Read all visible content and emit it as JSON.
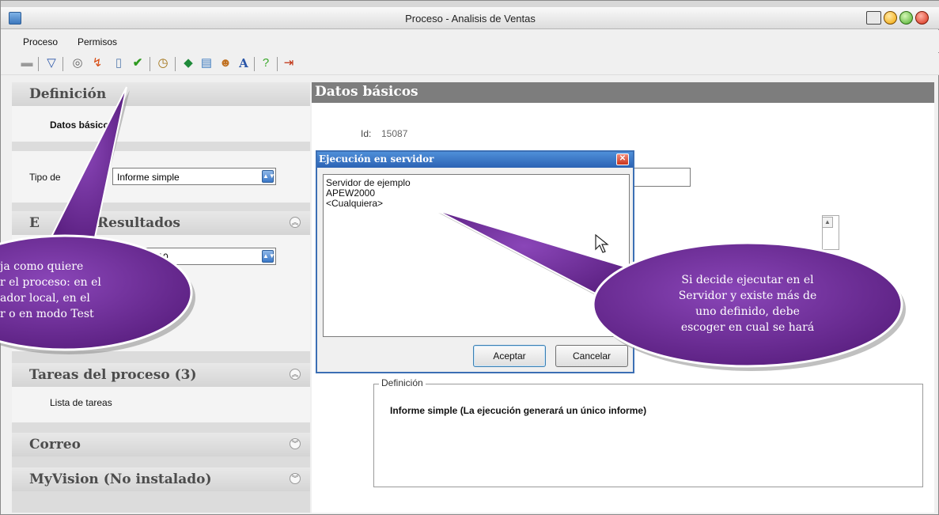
{
  "window": {
    "title": "Proceso - Analisis de Ventas"
  },
  "menu": {
    "items": [
      "Proceso",
      "Permisos"
    ]
  },
  "toolbar": {
    "icons": [
      "save-icon",
      "filter-icon",
      "run-icon",
      "bolt-icon",
      "shield-icon",
      "check-icon",
      "clock-icon",
      "eye-icon",
      "form-icon",
      "users-icon",
      "font-icon",
      "help-icon",
      "exit-icon"
    ]
  },
  "sidebar": {
    "definicion": {
      "title": "Definición",
      "item": "Datos básicos",
      "tipo_label": "Tipo de",
      "tipo_value": "Informe simple"
    },
    "resultados": {
      "title": "Resultados",
      "prefix": "E",
      "select_value": "2010"
    },
    "tareas": {
      "title": "Tareas del proceso (3)",
      "item": "Lista de tareas"
    },
    "correo": {
      "title": "Correo"
    },
    "myvision": {
      "title": "MyVision (No instalado)"
    }
  },
  "content": {
    "title": "Datos básicos",
    "id_label": "Id:",
    "id_value": "15087",
    "definicion_legend": "Definición",
    "definicion_text": "Informe simple (La ejecución generará un único informe)"
  },
  "dialog": {
    "title": "Ejecución en servidor",
    "servers": [
      "Servidor de ejemplo",
      "APEW2000",
      "<Cualquiera>"
    ],
    "accept_label": "Aceptar",
    "cancel_label": "Cancelar"
  },
  "callouts": {
    "left_lines": [
      "ja como quiere",
      "r el proceso: en el",
      "ador local, en el",
      "r o en modo Test"
    ],
    "right_lines": [
      "Si decide ejecutar en el",
      "Servidor y existe más de",
      "uno definido, debe",
      "escoger en cual se hará"
    ]
  },
  "colors": {
    "callout": "#6e2d96",
    "dialog_title": "#2b62b3",
    "content_header": "#7d7d7d"
  }
}
